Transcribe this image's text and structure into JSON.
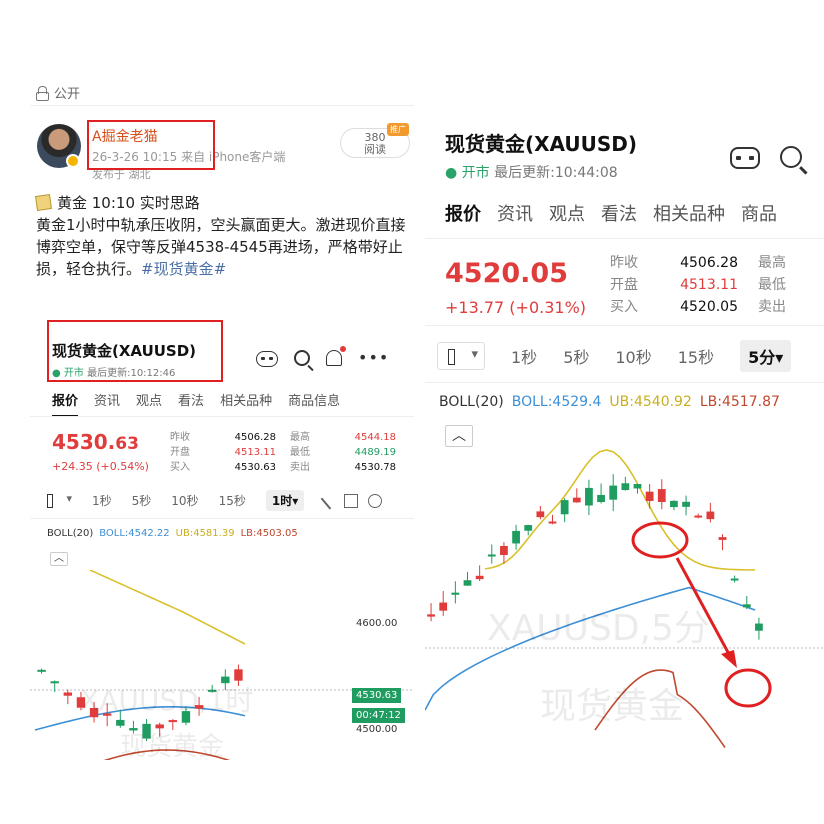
{
  "colors": {
    "up": "#e03c3c",
    "down": "#1f9d60",
    "boll_mid": "#3d8fd6",
    "ub": "#d9c02a",
    "lb": "#c0482f",
    "annotation": "#e02020"
  },
  "left": {
    "visibility": "公开",
    "user": {
      "name": "A掘金老猫",
      "time": "26-3-26 10:15",
      "source": "来自 iPhone客户端",
      "location": "发布于 湖北"
    },
    "reads": {
      "count": "380",
      "label": "阅读",
      "promo": "推广"
    },
    "post": {
      "line1": "黄金 10:10 实时思路",
      "line2": "黄金1小时中轨承压收阴，空头赢面更大。激进现价直接博弈空单，保守等反弹4538-4545再进场，严格带好止损，轻仓执行。",
      "hashtag": "#现货黄金#"
    },
    "app": {
      "title": "现货黄金(XAUUSD)",
      "status_open": "开市",
      "updated": "最后更新:10:12:46",
      "tabs": [
        "报价",
        "资讯",
        "观点",
        "看法",
        "相关品种",
        "商品信息"
      ],
      "price_int": "4530.",
      "price_dec": "63",
      "change": "+24.35 (+0.54%)",
      "quote": [
        {
          "label": "昨收",
          "value": "4506.28",
          "label2": "最高",
          "value2": "4544.18"
        },
        {
          "label": "开盘",
          "value": "4513.11",
          "label2": "最低",
          "value2": "4489.19"
        },
        {
          "label": "买入",
          "value": "4530.63",
          "label2": "卖出",
          "value2": "4530.78"
        }
      ],
      "timeframes": [
        "1秒",
        "5秒",
        "10秒",
        "15秒"
      ],
      "active_tf": "1时",
      "boll": {
        "name": "BOLL(20)",
        "mid": "BOLL:4542.22",
        "ub": "UB:4581.39",
        "lb": "LB:4503.05"
      },
      "axis": {
        "level_high": "4600.00",
        "level_low": "4500.00",
        "last_price": "4530.63",
        "countdown": "00:47:12"
      },
      "watermark": "XAUUSD,1时",
      "watermark2": "现货黄金"
    }
  },
  "right": {
    "title": "现货黄金(XAUUSD)",
    "status_open": "开市",
    "updated": "最后更新:10:44:08",
    "tabs": [
      "报价",
      "资讯",
      "观点",
      "看法",
      "相关品种",
      "商品"
    ],
    "price": "4520.05",
    "change": "+13.77 (+0.31%)",
    "quote": [
      {
        "label": "昨收",
        "value": "4506.28",
        "label2": "最高"
      },
      {
        "label": "开盘",
        "value": "4513.11",
        "label2": "最低"
      },
      {
        "label": "买入",
        "value": "4520.05",
        "label2": "卖出"
      }
    ],
    "timeframes": [
      "1秒",
      "5秒",
      "10秒",
      "15秒"
    ],
    "active_tf": "5分",
    "boll": {
      "name": "BOLL(20)",
      "mid": "BOLL:4529.4",
      "ub": "UB:4540.92",
      "lb": "LB:4517.87"
    },
    "watermark": "XAUUSD,5分",
    "watermark2": "现货黄金"
  }
}
